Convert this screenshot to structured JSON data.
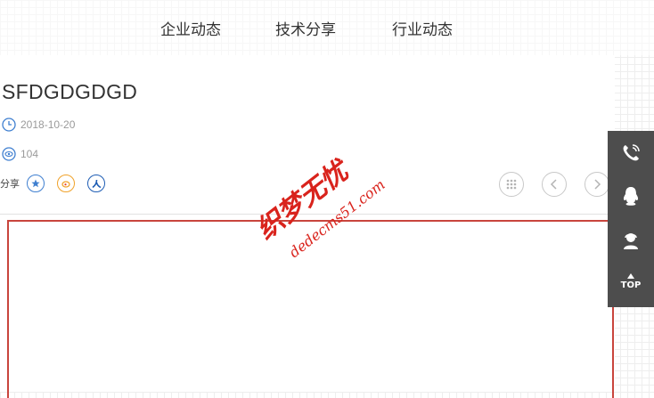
{
  "nav": {
    "items": [
      "企业动态",
      "技术分享",
      "行业动态"
    ]
  },
  "article": {
    "title": "SFDGDGDGD",
    "date": "2018-10-20",
    "views": "104",
    "share_label": "分享"
  },
  "sidebar": {
    "icons": [
      "phone-icon",
      "qq-icon",
      "customer-service-icon",
      "top-arrow-icon"
    ],
    "top_label": "TOP"
  },
  "watermark": {
    "line1": "织梦无忧",
    "line2": "dedecms51.com",
    "color": "#d9231c"
  },
  "colors": {
    "accent_red": "#c9453d",
    "sidebar_bg": "#4d4d4d",
    "meta_gray": "#9a9a9a",
    "share_blue": "#3f7fd0",
    "share_orange": "#f0a22a"
  }
}
